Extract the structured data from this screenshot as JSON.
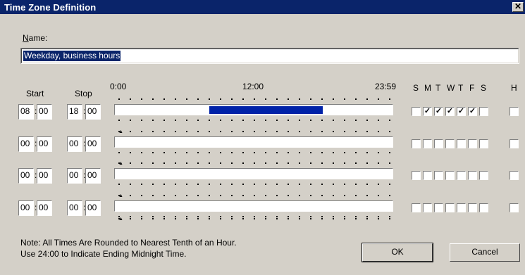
{
  "window": {
    "title": "Time Zone Definition",
    "close_label": "✕"
  },
  "name": {
    "label_prefix": "N",
    "label_rest": "ame:",
    "value": "Weekday, business hours"
  },
  "headers": {
    "start": "Start",
    "stop": "Stop",
    "t0": "0:00",
    "t12": "12:00",
    "t24": "23:59"
  },
  "days": [
    "S",
    "M",
    "T",
    "W",
    "T",
    "F",
    "S"
  ],
  "holiday": "H",
  "rows": [
    {
      "start_h": "08",
      "start_m": "00",
      "stop_h": "18",
      "stop_m": "00",
      "fill_start": 8,
      "fill_end": 18,
      "days": [
        false,
        true,
        true,
        true,
        true,
        true,
        false
      ],
      "holiday": false
    },
    {
      "start_h": "00",
      "start_m": "00",
      "stop_h": "00",
      "stop_m": "00",
      "fill_start": 0,
      "fill_end": 0,
      "days": [
        false,
        false,
        false,
        false,
        false,
        false,
        false
      ],
      "holiday": false
    },
    {
      "start_h": "00",
      "start_m": "00",
      "stop_h": "00",
      "stop_m": "00",
      "fill_start": 0,
      "fill_end": 0,
      "days": [
        false,
        false,
        false,
        false,
        false,
        false,
        false
      ],
      "holiday": false
    },
    {
      "start_h": "00",
      "start_m": "00",
      "stop_h": "00",
      "stop_m": "00",
      "fill_start": 0,
      "fill_end": 0,
      "days": [
        false,
        false,
        false,
        false,
        false,
        false,
        false
      ],
      "holiday": false
    }
  ],
  "note": {
    "line1": "Note: All Times Are Rounded to Nearest Tenth of an Hour.",
    "line2": "Use 24:00 to Indicate Ending Midnight Time."
  },
  "buttons": {
    "ok": "OK",
    "cancel": "Cancel"
  }
}
